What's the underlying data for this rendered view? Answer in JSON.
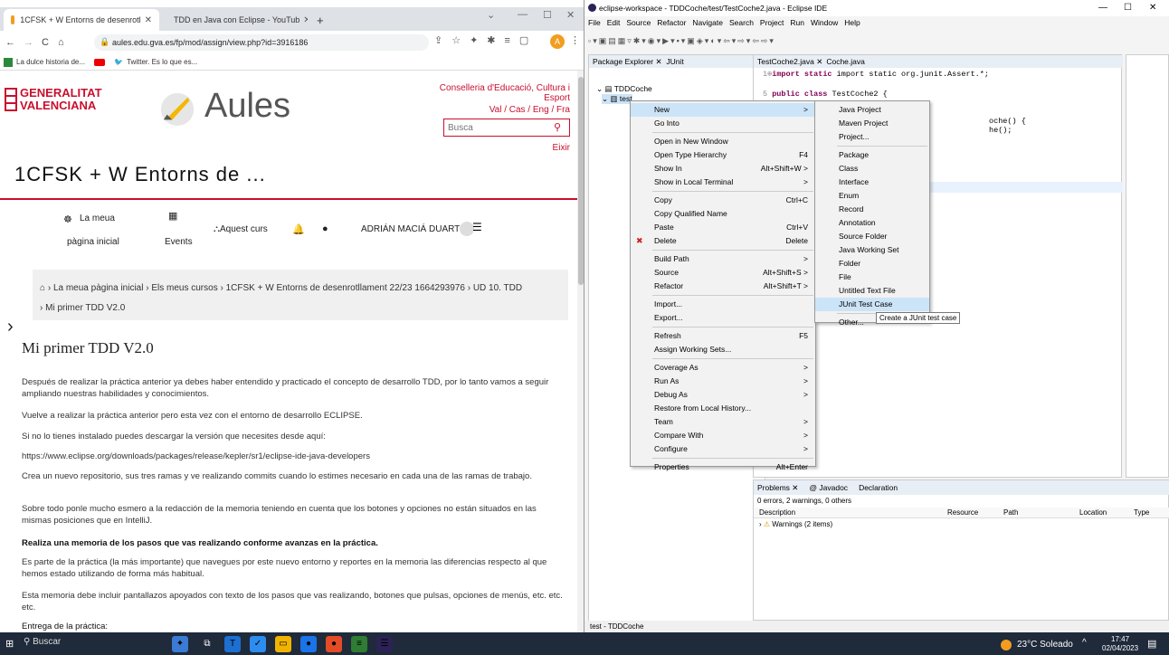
{
  "chrome": {
    "tabs": [
      {
        "title": "1CFSK + W Entorns de desenrotl",
        "active": true
      },
      {
        "title": "TDD en Java con Eclipse - YouTub",
        "active": false
      }
    ],
    "add_tab": "+",
    "url": "aules.edu.gva.es/fp/mod/assign/view.php?id=3916186",
    "bookmarks": [
      "La dulce historia de...",
      "",
      "Twitter. Es lo que es..."
    ],
    "site": {
      "org_line1": "GENERALITAT",
      "org_line2": "VALENCIANA",
      "brand": "Aules",
      "conselleria": "Conselleria d'Educació, Cultura i Esport",
      "langs": "Val / Cas / Eng / Fra",
      "search_placeholder": "Busca",
      "logout": "Eixir",
      "course_title": "1CFSK + W Entorns de ...",
      "nav": {
        "home_line1": "La meua",
        "home_line2": "pàgina inicial",
        "events": "Events",
        "this_course": "Aquest curs",
        "user": "ADRIÁN MACIÁ DUARTE"
      },
      "breadcrumb": [
        "La meua pàgina inicial",
        "Els meus cursos",
        "1CFSK + W Entorns de desenrotllament 22/23 1664293976",
        "UD 10. TDD",
        "Mi primer TDD V2.0"
      ],
      "heading": "Mi primer TDD V2.0",
      "paragraphs": [
        "Después de realizar la práctica anterior ya debes haber entendido y practicado el concepto de desarrollo TDD, por lo tanto vamos a seguir ampliando nuestras habilidades y conocimientos.",
        "Vuelve a realizar la práctica anterior pero esta vez con el entorno de desarrollo ECLIPSE.",
        "Si no lo tienes instalado puedes descargar la versión que necesites desde aquí:",
        "https://www.eclipse.org/downloads/packages/release/kepler/sr1/eclipse-ide-java-developers",
        "Crea un nuevo repositorio, sus tres ramas y ve realizando commits cuando lo estimes necesario en cada una de las ramas de trabajo.",
        "Sobre todo ponle mucho esmero a la redacción de la memoria teniendo en cuenta que los botones y opciones no están situados en las mismas posiciones que en IntelliJ.",
        "Realiza una memoria de los pasos que vas realizando conforme avanzas en la práctica.",
        "Es parte de la práctica (la más importante) que navegues por este nuevo entorno y reportes en la memoria las diferencias respecto al que hemos estado utilizando de forma más habitual.",
        "Esta memoria debe incluir pantallazos apoyados con texto de los pasos que vas realizando, botones que pulsas, opciones de menús, etc. etc. etc.",
        "Entrega de la práctica:"
      ]
    }
  },
  "eclipse": {
    "title": "eclipse-workspace - TDDCoche/test/TestCoche2.java - Eclipse IDE",
    "menu": [
      "File",
      "Edit",
      "Source",
      "Refactor",
      "Navigate",
      "Search",
      "Project",
      "Run",
      "Window",
      "Help"
    ],
    "views": {
      "package_explorer": "Package Explorer",
      "junit": "JUnit"
    },
    "tree": [
      "TDDCoche",
      "test"
    ],
    "editor_tabs": [
      "TestCoche2.java",
      "Coche.java"
    ],
    "code": {
      "line1": "import static org.junit.Assert.*;",
      "line5_kw": "public class",
      "line5_rest": " TestCoche2 {",
      "frag1": "oche() {",
      "frag2": "he();"
    },
    "context_menu": [
      {
        "label": "New",
        "shortcut": "",
        "arrow": true,
        "hl": true
      },
      {
        "label": "Go Into",
        "shortcut": ""
      },
      {
        "sep": true
      },
      {
        "label": "Open in New Window",
        "shortcut": ""
      },
      {
        "label": "Open Type Hierarchy",
        "shortcut": "F4"
      },
      {
        "label": "Show In",
        "shortcut": "Alt+Shift+W >"
      },
      {
        "label": "Show in Local Terminal",
        "shortcut": ">"
      },
      {
        "sep": true
      },
      {
        "label": "Copy",
        "shortcut": "Ctrl+C"
      },
      {
        "label": "Copy Qualified Name",
        "shortcut": ""
      },
      {
        "label": "Paste",
        "shortcut": "Ctrl+V"
      },
      {
        "label": "Delete",
        "shortcut": "Delete",
        "icon": "✖",
        "icon_color": "#d02020"
      },
      {
        "sep": true
      },
      {
        "label": "Build Path",
        "shortcut": ">"
      },
      {
        "label": "Source",
        "shortcut": "Alt+Shift+S >"
      },
      {
        "label": "Refactor",
        "shortcut": "Alt+Shift+T >"
      },
      {
        "sep": true
      },
      {
        "label": "Import...",
        "shortcut": ""
      },
      {
        "label": "Export...",
        "shortcut": ""
      },
      {
        "sep": true
      },
      {
        "label": "Refresh",
        "shortcut": "F5"
      },
      {
        "label": "Assign Working Sets...",
        "shortcut": ""
      },
      {
        "sep": true
      },
      {
        "label": "Coverage As",
        "shortcut": ">"
      },
      {
        "label": "Run As",
        "shortcut": ">"
      },
      {
        "label": "Debug As",
        "shortcut": ">"
      },
      {
        "label": "Restore from Local History...",
        "shortcut": ""
      },
      {
        "label": "Team",
        "shortcut": ">"
      },
      {
        "label": "Compare With",
        "shortcut": ">"
      },
      {
        "label": "Configure",
        "shortcut": ">"
      },
      {
        "sep": true
      },
      {
        "label": "Properties",
        "shortcut": "Alt+Enter"
      }
    ],
    "submenu": [
      {
        "label": "Java Project"
      },
      {
        "label": "Maven Project"
      },
      {
        "label": "Project..."
      },
      {
        "sep": true
      },
      {
        "label": "Package"
      },
      {
        "label": "Class"
      },
      {
        "label": "Interface"
      },
      {
        "label": "Enum"
      },
      {
        "label": "Record"
      },
      {
        "label": "Annotation"
      },
      {
        "label": "Source Folder"
      },
      {
        "label": "Java Working Set"
      },
      {
        "label": "Folder"
      },
      {
        "label": "File"
      },
      {
        "label": "Untitled Text File"
      },
      {
        "label": "JUnit Test Case",
        "hl": true
      },
      {
        "sep": true
      },
      {
        "label": "Other..."
      }
    ],
    "tooltip": "Create a JUnit test case",
    "problems": {
      "tabs": [
        "Problems",
        "Javadoc",
        "Declaration"
      ],
      "summary": "0 errors, 2 warnings, 0 others",
      "columns": [
        "Description",
        "Resource",
        "Path",
        "Location",
        "Type"
      ],
      "row": "Warnings (2 items)"
    },
    "status": "test - TDDCoche"
  },
  "taskbar": {
    "search": "Buscar",
    "weather": "23°C  Soleado",
    "time": "17:47",
    "date": "02/04/2023"
  }
}
